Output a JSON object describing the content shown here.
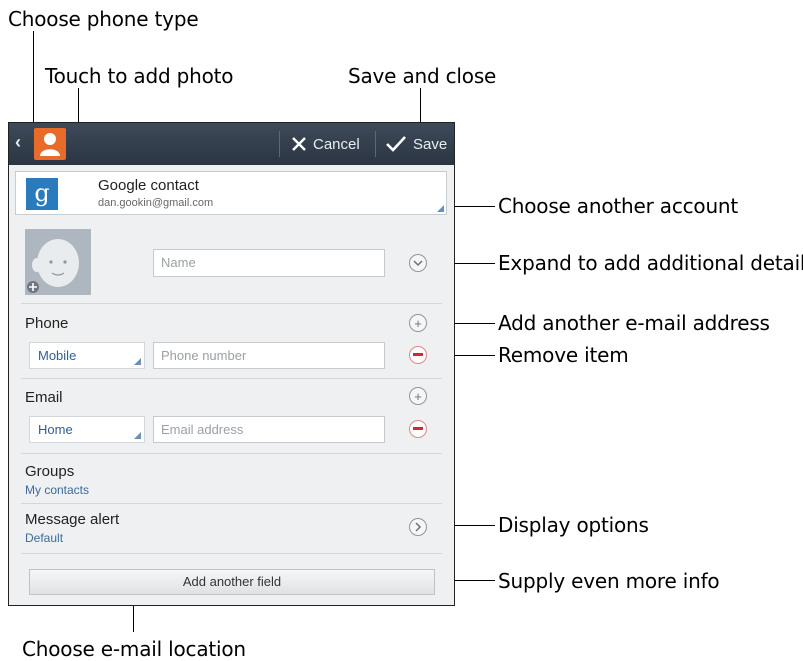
{
  "callouts": {
    "choose_phone_type": "Choose phone type",
    "touch_to_add_photo": "Touch to add photo",
    "save_and_close": "Save and close",
    "choose_another_account": "Choose another account",
    "expand_details": "Expand to add additional details",
    "add_email_address": "Add another e-mail address",
    "remove_item": "Remove item",
    "display_options": "Display options",
    "supply_more_info": "Supply even more info",
    "choose_email_location": "Choose e-mail location"
  },
  "titlebar": {
    "cancel_label": "Cancel",
    "save_label": "Save",
    "icons": [
      "back-chevron-icon",
      "contact-icon",
      "close-icon",
      "checkmark-icon"
    ]
  },
  "account": {
    "name": "Google contact",
    "email": "dan.gookin@gmail.com",
    "logo_letter": "g"
  },
  "name_field": {
    "placeholder": "Name"
  },
  "phone": {
    "label": "Phone",
    "type": "Mobile",
    "placeholder": "Phone number"
  },
  "email": {
    "label": "Email",
    "type": "Home",
    "placeholder": "Email address"
  },
  "groups": {
    "label": "Groups",
    "value": "My contacts"
  },
  "message_alert": {
    "label": "Message alert",
    "value": "Default"
  },
  "add_field_label": "Add another field",
  "colors": {
    "titlebar": "#34404e",
    "accent_orange": "#e86b2a",
    "google_blue": "#2a7bbd",
    "remove_red": "#d9262b",
    "link_blue": "#3d6b9a"
  }
}
